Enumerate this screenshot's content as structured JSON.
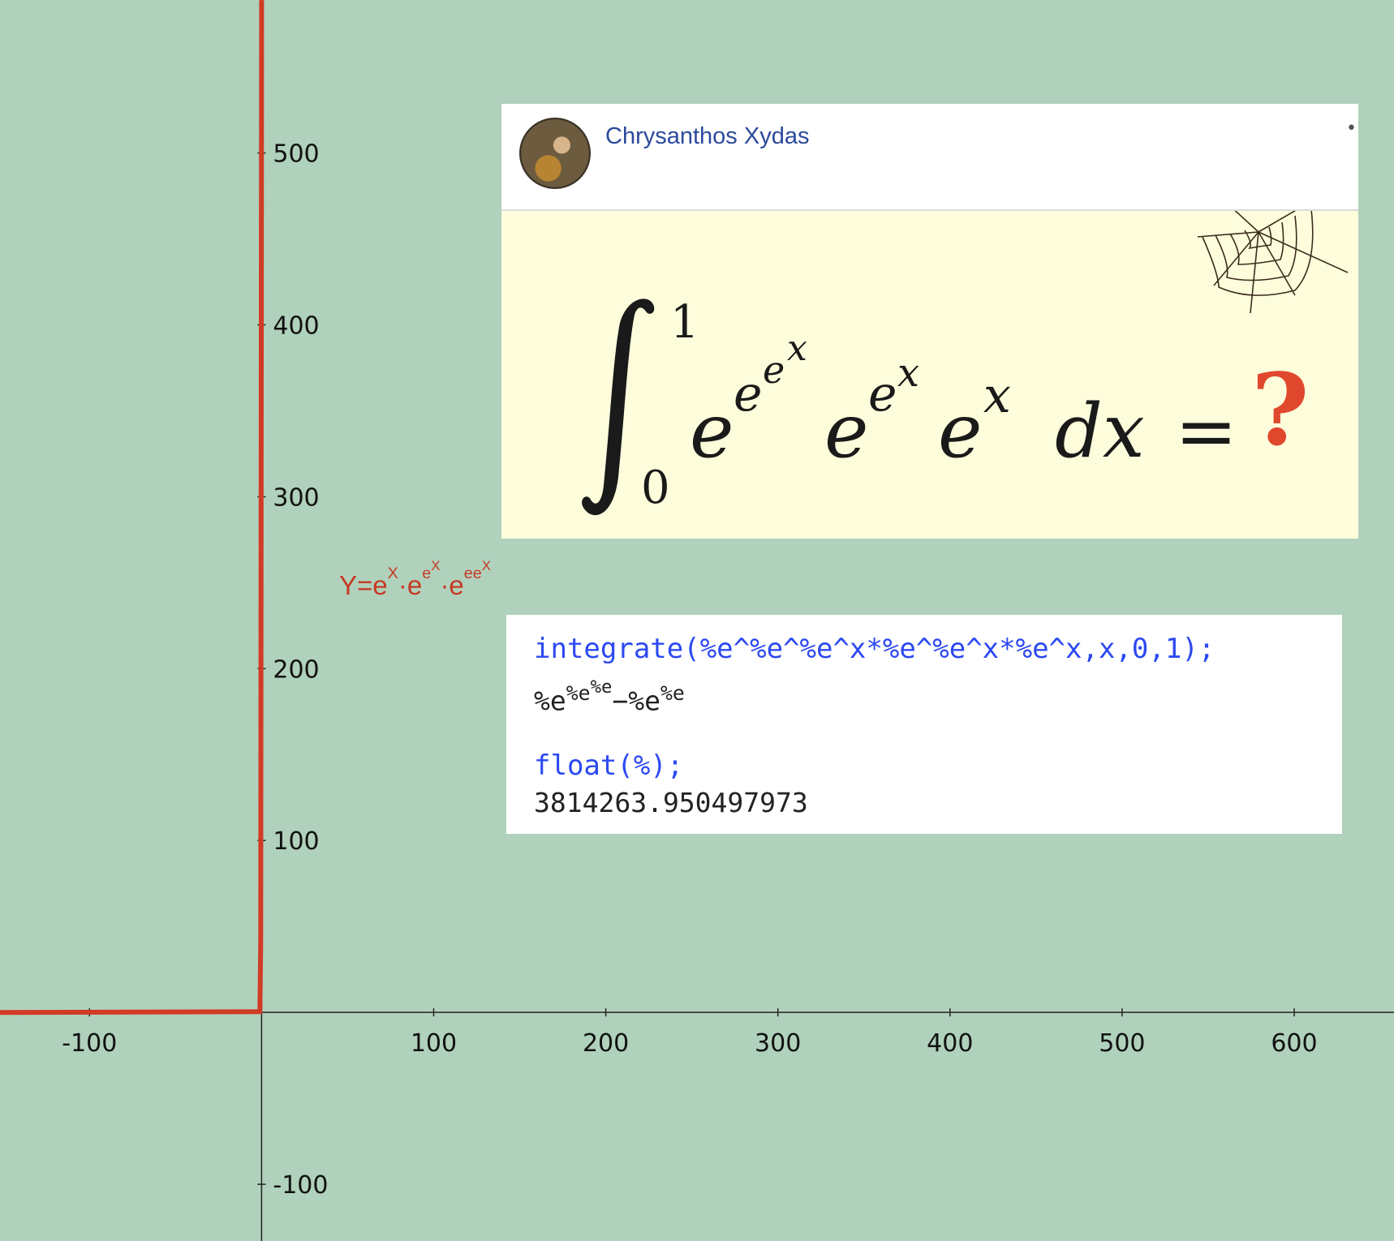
{
  "chart_data": {
    "type": "line",
    "xlim": [
      -152,
      658
    ],
    "ylim": [
      -133,
      589
    ],
    "x_ticks": [
      -100,
      100,
      200,
      300,
      400,
      500,
      600
    ],
    "y_ticks": [
      500,
      400,
      300,
      200,
      100,
      -100
    ],
    "series": [
      {
        "x": [
          -152,
          -1,
          -0.5,
          0,
          0.2
        ],
        "y": [
          0,
          0.4,
          40,
          588,
          589
        ],
        "color": "#d13b25"
      }
    ],
    "grid": false
  },
  "curve_label": {
    "prefix": "Y=e",
    "exp1": "X",
    "dot1": "·e",
    "exp2_base": "e",
    "exp2_top": "X",
    "dot2": "·e",
    "exp3_base": "ee",
    "exp3_top": "X",
    "color": "#d13b25"
  },
  "post": {
    "author": "Chrysanthos Xydas",
    "more_icon": "more-dots-icon",
    "formula": {
      "upper_limit": "1",
      "lower_limit": "0",
      "e": "e",
      "x": "x",
      "dx": "dx",
      "equals": "=",
      "question": "?",
      "question_color": "#e0482d"
    },
    "background": "#fdfddc"
  },
  "maxima": {
    "input1": "integrate(%e^%e^%e^x*%e^%e^x*%e^x,x,0,1);",
    "output1": {
      "base": "%e",
      "exp": "%e",
      "exp_top": "%e",
      "minus": "−%e",
      "exp2": "%e"
    },
    "input2": "float(%);",
    "output2": "3814263.950497973",
    "input_color": "#2c49f2"
  }
}
